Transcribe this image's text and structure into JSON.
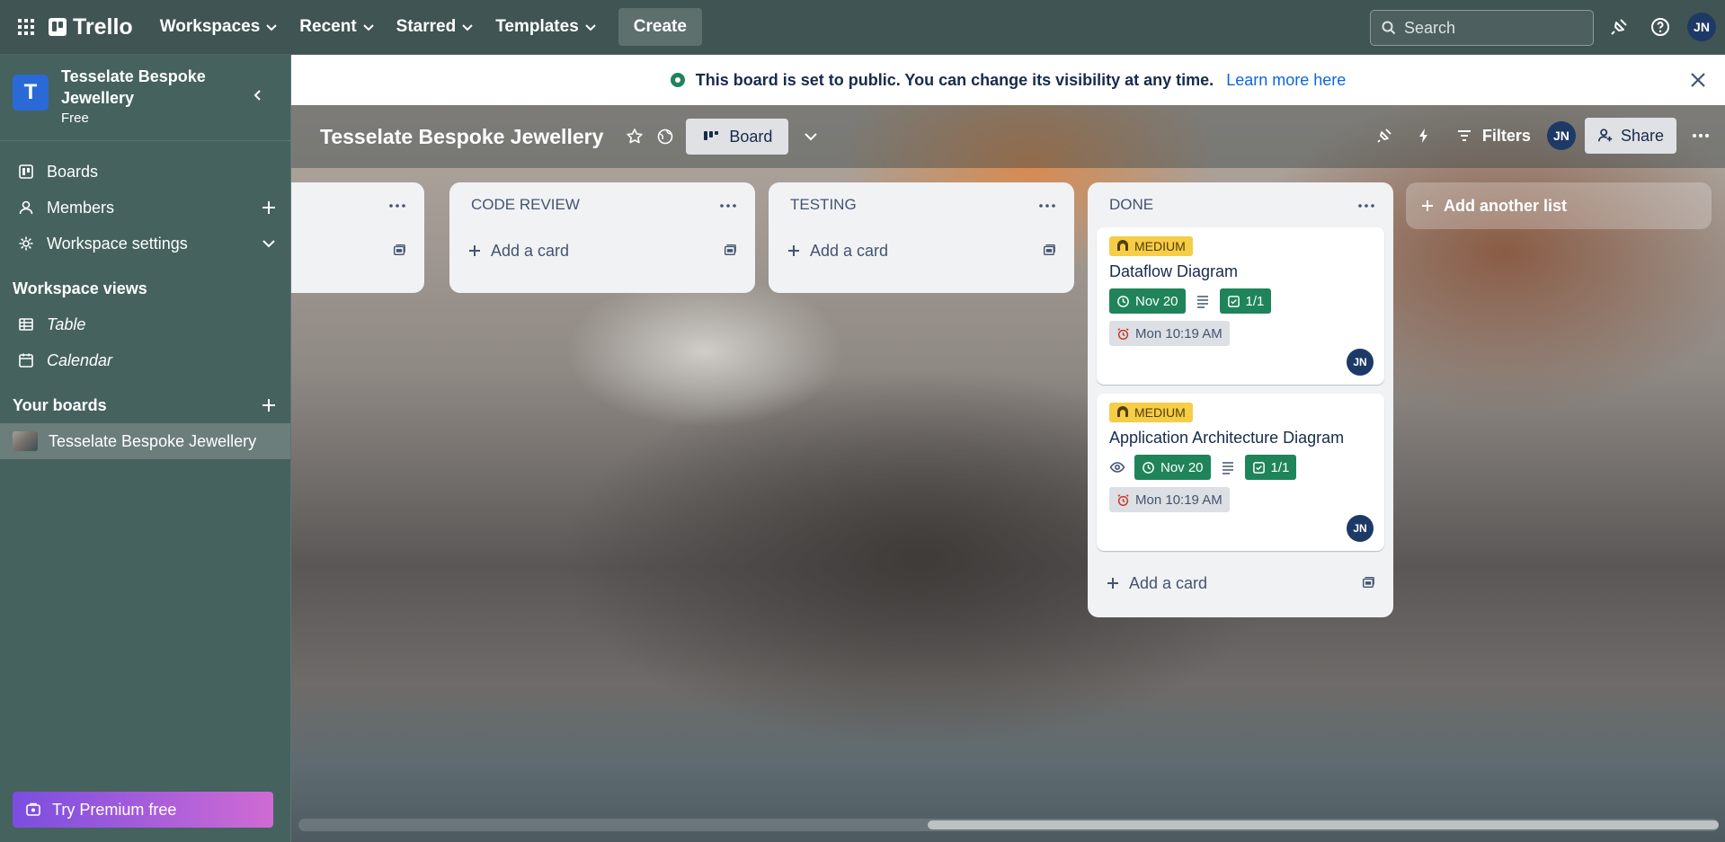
{
  "topnav": {
    "app_name": "Trello",
    "menus": [
      {
        "label": "Workspaces"
      },
      {
        "label": "Recent"
      },
      {
        "label": "Starred"
      },
      {
        "label": "Templates"
      }
    ],
    "create_label": "Create",
    "search_placeholder": "Search",
    "avatar_initials": "JN"
  },
  "sidebar": {
    "workspace_initial": "T",
    "workspace_name": "Tesselate Bespoke Jewellery",
    "workspace_plan": "Free",
    "items": [
      {
        "label": "Boards"
      },
      {
        "label": "Members"
      },
      {
        "label": "Workspace settings"
      }
    ],
    "views_heading": "Workspace views",
    "views": [
      {
        "label": "Table"
      },
      {
        "label": "Calendar"
      }
    ],
    "boards_heading": "Your boards",
    "boards": [
      {
        "label": "Tesselate Bespoke Jewellery"
      }
    ],
    "premium_label": "Try Premium free"
  },
  "banner": {
    "message": "This board is set to public. You can change its visibility at any time.",
    "link": "Learn more here"
  },
  "board": {
    "title": "Tesselate Bespoke Jewellery",
    "view_label": "Board",
    "filters_label": "Filters",
    "share_label": "Share",
    "member_initials": "JN"
  },
  "lists": [
    {
      "title": "",
      "add_card": ""
    },
    {
      "title": "CODE REVIEW",
      "add_card": "Add a card"
    },
    {
      "title": "TESTING",
      "add_card": "Add a card"
    },
    {
      "title": "DONE",
      "add_card": "Add a card",
      "cards": [
        {
          "label": "MEDIUM",
          "title": "Dataflow Diagram",
          "due": "Nov 20",
          "checklist": "1/1",
          "reminder": "Mon 10:19 AM",
          "member": "JN"
        },
        {
          "label": "MEDIUM",
          "title": "Application Architecture Diagram",
          "due": "Nov 20",
          "checklist": "1/1",
          "reminder": "Mon 10:19 AM",
          "member": "JN"
        }
      ]
    }
  ],
  "add_list_label": "Add another list",
  "colors": {
    "topnav_bg": "#3f5453",
    "sidebar_bg": "#45625f",
    "label_medium": "#f5cd47",
    "due_complete": "#1f845a",
    "link": "#0c66e4",
    "premium_start": "#7a4ee0",
    "premium_end": "#d06bd4"
  }
}
